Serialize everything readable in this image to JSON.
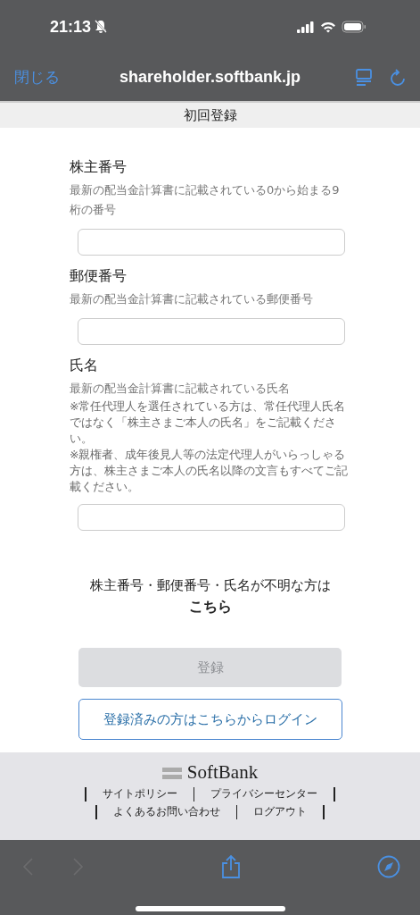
{
  "status_bar": {
    "time": "21:13"
  },
  "browser": {
    "close": "閉じる",
    "url": "shareholder.softbank.jp"
  },
  "page_title": "初回登録",
  "fields": [
    {
      "label": "株主番号",
      "description": "最新の配当金計算書に記載されている0から始まる9桁の番号"
    },
    {
      "label": "郵便番号",
      "description": "最新の配当金計算書に記載されている郵便番号"
    },
    {
      "label": "氏名",
      "description": "最新の配当金計算書に記載されている氏名",
      "notes": [
        "※常任代理人を選任されている方は、常任代理人氏名ではなく「株主さまご本人の氏名」をご記載ください。",
        "※親権者、成年後見人等の法定代理人がいらっしゃる方は、株主さまご本人の氏名以降の文言もすべてご記載ください。"
      ]
    }
  ],
  "help": {
    "text": "株主番号・郵便番号・氏名が不明な方は",
    "link": "こちら"
  },
  "register_button": {
    "label": "登録",
    "disabled": true
  },
  "login_button": {
    "label": "登録済みの方はこちらからログイン"
  },
  "footer": {
    "logo": "SoftBank",
    "link_rows": [
      [
        "サイトポリシー",
        "プライバシーセンター"
      ],
      [
        "よくあるお問い合わせ",
        "ログアウト"
      ]
    ]
  },
  "toolbar": {
    "back": {
      "disabled": true
    },
    "forward": {
      "disabled": true
    }
  }
}
